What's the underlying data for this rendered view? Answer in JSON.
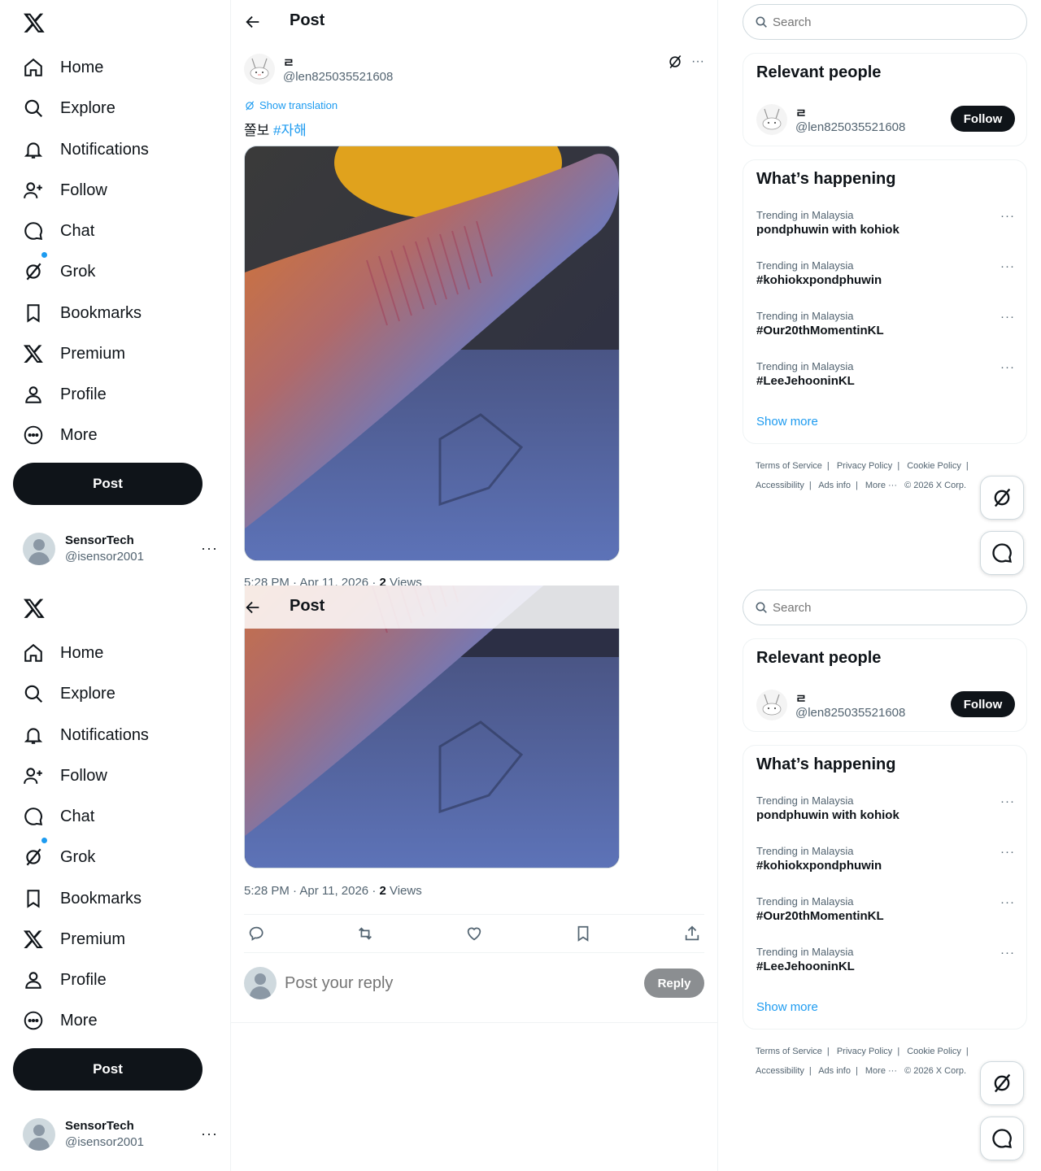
{
  "nav": {
    "items": [
      {
        "label": "Home",
        "icon": "home-icon"
      },
      {
        "label": "Explore",
        "icon": "search-icon"
      },
      {
        "label": "Notifications",
        "icon": "bell-icon"
      },
      {
        "label": "Follow",
        "icon": "add-user-icon"
      },
      {
        "label": "Chat",
        "icon": "chat-bubble-icon"
      },
      {
        "label": "Grok",
        "icon": "grok-icon"
      },
      {
        "label": "Bookmarks",
        "icon": "bookmark-icon"
      },
      {
        "label": "Premium",
        "icon": "x-logo-icon"
      },
      {
        "label": "Profile",
        "icon": "person-icon"
      },
      {
        "label": "More",
        "icon": "more-circle-icon"
      }
    ],
    "post_label": "Post"
  },
  "account": {
    "name": "SensorTech",
    "handle": "@isensor2001",
    "more": "···"
  },
  "header": {
    "title": "Post"
  },
  "post": {
    "author_name": "ㄹ",
    "author_handle": "@len825035521608",
    "show_translation": "Show translation",
    "text": "쫄보",
    "hashtag": "#자해",
    "time": "5:28 PM · Apr 11, 2026 · ",
    "views_count": "2",
    "views_label": " Views",
    "more": "···"
  },
  "reply": {
    "placeholder": "Post your reply",
    "button": "Reply"
  },
  "search": {
    "placeholder": "Search"
  },
  "relevant": {
    "title": "Relevant people",
    "name": "ㄹ",
    "handle": "@len825035521608",
    "follow": "Follow"
  },
  "trends": {
    "title": "What’s happening",
    "items": [
      {
        "category": "Trending in Malaysia",
        "name": "pondphuwin with kohiok"
      },
      {
        "category": "Trending in Malaysia",
        "name": "#kohiokxpondphuwin"
      },
      {
        "category": "Trending in Malaysia",
        "name": "#Our20thMomentinKL"
      },
      {
        "category": "Trending in Malaysia",
        "name": "#LeeJehooninKL"
      }
    ],
    "show_more": "Show more",
    "more": "···"
  },
  "footer": {
    "links": [
      "Terms of Service",
      "Privacy Policy",
      "Cookie Policy",
      "Accessibility",
      "Ads info",
      "More ···",
      "© 2026 X Corp."
    ],
    "sep": "|"
  },
  "colors": {
    "accent": "#1d9bf0",
    "text": "#0f1419",
    "muted": "#536471",
    "border": "#eff3f4"
  }
}
